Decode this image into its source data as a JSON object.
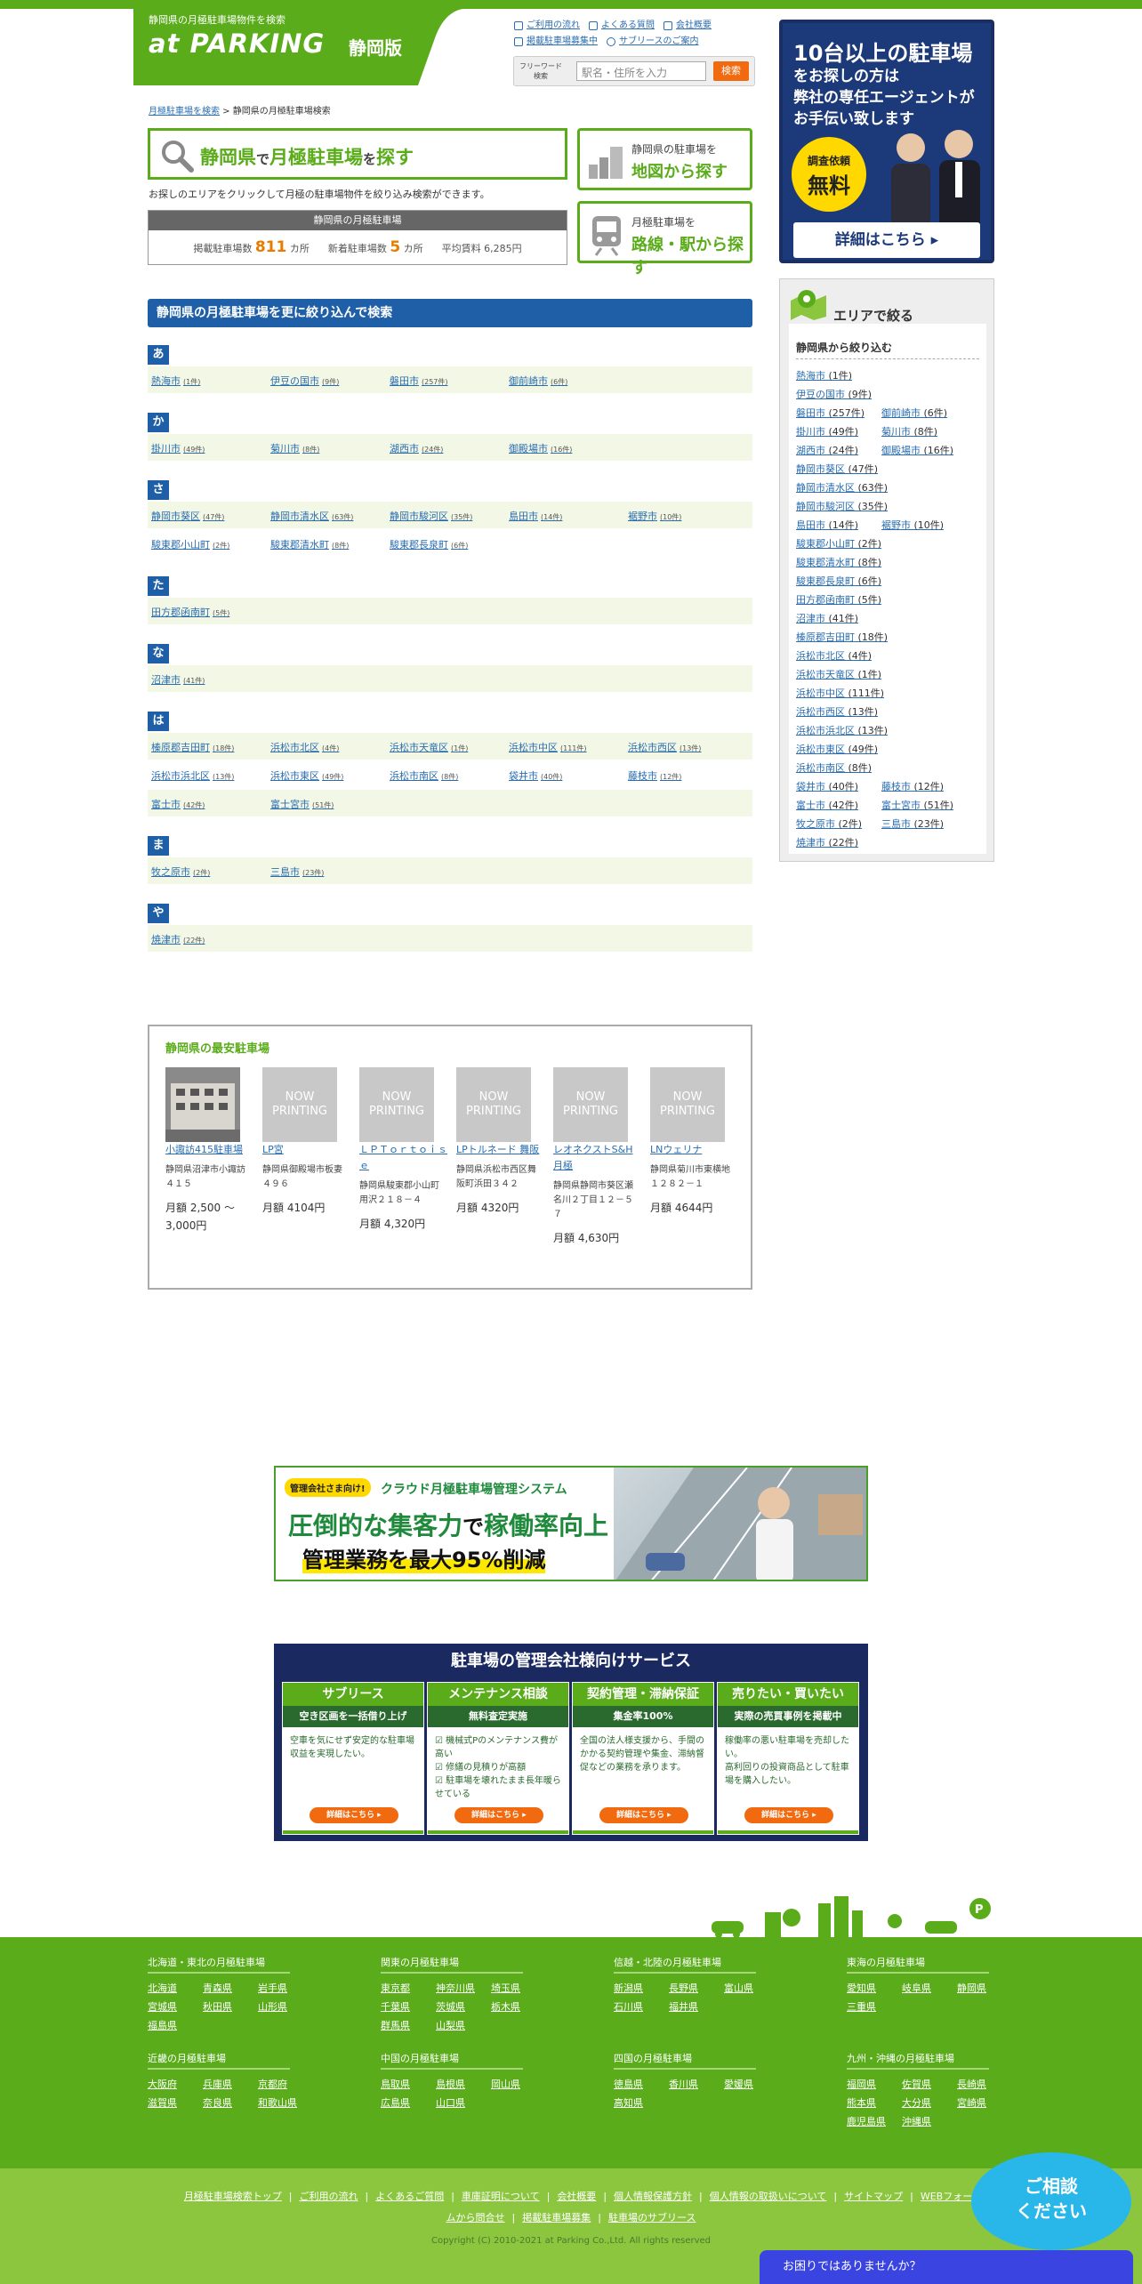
{
  "header": {
    "tagline": "静岡県の月極駐車場物件を検索",
    "logo": "at PARKING",
    "edition": "静岡版",
    "links": [
      "ご利用の流れ",
      "よくある質問",
      "会社概要",
      "掲載駐車場募集中",
      "サブリースのご案内"
    ],
    "search_label": "フリーワード検索",
    "search_placeholder": "駅名・住所を入力",
    "search_button": "検索"
  },
  "ad_top": {
    "line1": "10台以上の駐車場",
    "line2": "をお探しの方は",
    "line3": "弊社の専任エージェントが",
    "line4": "お手伝い致します",
    "badge1": "調査依頼",
    "badge2": "無料",
    "detail": "詳細はこちら ▸"
  },
  "breadcrumb": {
    "home": "月極駐車場を検索",
    "sep": " > ",
    "current": "静岡県の月極駐車場検索"
  },
  "title": {
    "pref": "静岡県",
    "de": "で",
    "mid": "月極駐車場",
    "wo": "を",
    "end": "探す"
  },
  "intro": "お探しのエリアをクリックして月極の駐車場物件を絞り込み検索ができます。",
  "stats": {
    "header": "静岡県の月極駐車場",
    "label1": "掲載駐車場数",
    "value1": "811",
    "unit1": "カ所",
    "label2": "新着駐車場数",
    "value2": "5",
    "unit2": "カ所",
    "label3": "平均賃料",
    "value3": "6,285円"
  },
  "side_buttons": [
    {
      "l1": "静岡県の駐車場を",
      "l2": "地図から探す"
    },
    {
      "l1": "月極駐車場を",
      "l2": "路線・駅から探す"
    }
  ],
  "section_title": "静岡県の月極駐車場を更に絞り込んで検索",
  "kana_groups": [
    {
      "kana": "あ",
      "rows": [
        [
          [
            "熱海市",
            "(1件)"
          ],
          [
            "伊豆の国市",
            "(9件)"
          ],
          [
            "磐田市",
            "(257件)"
          ],
          [
            "御前崎市",
            "(6件)"
          ]
        ]
      ]
    },
    {
      "kana": "か",
      "rows": [
        [
          [
            "掛川市",
            "(49件)"
          ],
          [
            "菊川市",
            "(8件)"
          ],
          [
            "湖西市",
            "(24件)"
          ],
          [
            "御殿場市",
            "(16件)"
          ]
        ]
      ]
    },
    {
      "kana": "さ",
      "rows": [
        [
          [
            "静岡市葵区",
            "(47件)"
          ],
          [
            "静岡市清水区",
            "(63件)"
          ],
          [
            "静岡市駿河区",
            "(35件)"
          ],
          [
            "島田市",
            "(14件)"
          ],
          [
            "裾野市",
            "(10件)"
          ]
        ],
        [
          [
            "駿東郡小山町",
            "(2件)"
          ],
          [
            "駿東郡清水町",
            "(8件)"
          ],
          [
            "駿東郡長泉町",
            "(6件)"
          ]
        ]
      ]
    },
    {
      "kana": "た",
      "rows": [
        [
          [
            "田方郡函南町",
            "(5件)"
          ]
        ]
      ]
    },
    {
      "kana": "な",
      "rows": [
        [
          [
            "沼津市",
            "(41件)"
          ]
        ]
      ]
    },
    {
      "kana": "は",
      "rows": [
        [
          [
            "榛原郡吉田町",
            "(18件)"
          ],
          [
            "浜松市北区",
            "(4件)"
          ],
          [
            "浜松市天竜区",
            "(1件)"
          ],
          [
            "浜松市中区",
            "(111件)"
          ],
          [
            "浜松市西区",
            "(13件)"
          ]
        ],
        [
          [
            "浜松市浜北区",
            "(13件)"
          ],
          [
            "浜松市東区",
            "(49件)"
          ],
          [
            "浜松市南区",
            "(8件)"
          ],
          [
            "袋井市",
            "(40件)"
          ],
          [
            "藤枝市",
            "(12件)"
          ]
        ],
        [
          [
            "富士市",
            "(42件)"
          ],
          [
            "富士宮市",
            "(51件)"
          ]
        ]
      ]
    },
    {
      "kana": "ま",
      "rows": [
        [
          [
            "牧之原市",
            "(2件)"
          ],
          [
            "三島市",
            "(23件)"
          ]
        ]
      ]
    },
    {
      "kana": "や",
      "rows": [
        [
          [
            "焼津市",
            "(22件)"
          ]
        ]
      ]
    }
  ],
  "cheapest": {
    "title": "静岡県の最安駐車場",
    "items": [
      {
        "img": "",
        "name": "小諏訪415駐車場",
        "addr": "静岡県沼津市小諏訪４１５",
        "price": "月額 2,500 ～ 3,000円"
      },
      {
        "img": "NOW PRINTING",
        "name": "LP宮",
        "addr": "静岡県御殿場市板妻４９６",
        "price": "月額 4104円"
      },
      {
        "img": "NOW PRINTING",
        "name": "ＬＰＴｏｒｔｏｉｓｅ",
        "addr": "静岡県駿東郡小山町用沢２１８－４",
        "price": "月額 4,320円"
      },
      {
        "img": "NOW PRINTING",
        "name": "LPトルネード 舞阪",
        "addr": "静岡県浜松市西区舞阪町浜田３４２",
        "price": "月額 4320円"
      },
      {
        "img": "NOW PRINTING",
        "name": "レオネクストS&H月極",
        "addr": "静岡県静岡市葵区瀬名川２丁目１２－５７",
        "price": "月額 4,630円"
      },
      {
        "img": "NOW PRINTING",
        "name": "LNウェリナ",
        "addr": "静岡県菊川市東横地１２８２－１",
        "price": "月額 4644円"
      }
    ]
  },
  "banner1": {
    "tag": "管理会社さま向け!",
    "title": "クラウド月極駐車場管理システム",
    "l1a": "圧倒的な集客力",
    "l1b": "で",
    "l1c": "稼働率向上",
    "l2": "管理業務を最大95%削減"
  },
  "banner2": {
    "title": "駐車場の管理会社様向けサービス",
    "cols": [
      {
        "h": "サブリース",
        "s": "空き区画を一括借り上げ",
        "t": "空車を気にせず安定的な駐車場収益を実現したい。",
        "b": "詳細はこちら ▸"
      },
      {
        "h": "メンテナンス相談",
        "s": "無料査定実施",
        "t": "☑ 機械式Pのメンテナンス費が高い\n☑ 修繕の見積りが高額\n☑ 駐車場を壊れたまま長年暖らせている",
        "b": "詳細はこちら ▸"
      },
      {
        "h": "契約管理・滞納保証",
        "s": "集金率100%",
        "t": "全国の法人様支援から、手間のかかる契約管理や集金、滞納督促などの業務を承ります。",
        "b": "詳細はこちら ▸"
      },
      {
        "h": "売りたい・買いたい",
        "s": "実際の売買事例を掲載中",
        "t": "稼働率の悪い駐車場を売却したい。\n高利回りの投資商品として駐車場を購入したい。",
        "b": "詳細はこちら ▸"
      }
    ]
  },
  "sidebar": {
    "title": "エリアで絞る",
    "subtitle": "静岡県から絞り込む",
    "rows": [
      [
        [
          "熱海市",
          "(1件)"
        ]
      ],
      [
        [
          "伊豆の国市",
          "(9件)"
        ]
      ],
      [
        [
          "磐田市",
          "(257件)"
        ],
        [
          "御前崎市",
          "(6件)"
        ]
      ],
      [
        [
          "掛川市",
          "(49件)"
        ],
        [
          "菊川市",
          "(8件)"
        ]
      ],
      [
        [
          "湖西市",
          "(24件)"
        ],
        [
          "御殿場市",
          "(16件)"
        ]
      ],
      [
        [
          "静岡市葵区",
          "(47件)"
        ]
      ],
      [
        [
          "静岡市清水区",
          "(63件)"
        ]
      ],
      [
        [
          "静岡市駿河区",
          "(35件)"
        ]
      ],
      [
        [
          "島田市",
          "(14件)"
        ],
        [
          "裾野市",
          "(10件)"
        ]
      ],
      [
        [
          "駿東郡小山町",
          "(2件)"
        ]
      ],
      [
        [
          "駿東郡清水町",
          "(8件)"
        ]
      ],
      [
        [
          "駿東郡長泉町",
          "(6件)"
        ]
      ],
      [
        [
          "田方郡函南町",
          "(5件)"
        ]
      ],
      [
        [
          "沼津市",
          "(41件)"
        ]
      ],
      [
        [
          "榛原郡吉田町",
          "(18件)"
        ]
      ],
      [
        [
          "浜松市北区",
          "(4件)"
        ]
      ],
      [
        [
          "浜松市天竜区",
          "(1件)"
        ]
      ],
      [
        [
          "浜松市中区",
          "(111件)"
        ]
      ],
      [
        [
          "浜松市西区",
          "(13件)"
        ]
      ],
      [
        [
          "浜松市浜北区",
          "(13件)"
        ]
      ],
      [
        [
          "浜松市東区",
          "(49件)"
        ]
      ],
      [
        [
          "浜松市南区",
          "(8件)"
        ]
      ],
      [
        [
          "袋井市",
          "(40件)"
        ],
        [
          "藤枝市",
          "(12件)"
        ]
      ],
      [
        [
          "富士市",
          "(42件)"
        ],
        [
          "富士宮市",
          "(51件)"
        ]
      ],
      [
        [
          "牧之原市",
          "(2件)"
        ],
        [
          "三島市",
          "(23件)"
        ]
      ],
      [
        [
          "焼津市",
          "(22件)"
        ]
      ]
    ]
  },
  "footer_regions": [
    {
      "h": "北海道・東北の月極駐車場",
      "items": [
        "北海道",
        "青森県",
        "岩手県",
        "宮城県",
        "秋田県",
        "山形県",
        "福島県"
      ]
    },
    {
      "h": "関東の月極駐車場",
      "items": [
        "東京都",
        "神奈川県",
        "埼玉県",
        "千葉県",
        "茨城県",
        "栃木県",
        "群馬県",
        "山梨県"
      ]
    },
    {
      "h": "信越・北陸の月極駐車場",
      "items": [
        "新潟県",
        "長野県",
        "富山県",
        "石川県",
        "福井県"
      ]
    },
    {
      "h": "東海の月極駐車場",
      "items": [
        "愛知県",
        "岐阜県",
        "静岡県",
        "三重県"
      ]
    },
    {
      "h": "近畿の月極駐車場",
      "items": [
        "大阪府",
        "兵庫県",
        "京都府",
        "滋賀県",
        "奈良県",
        "和歌山県"
      ]
    },
    {
      "h": "中国の月極駐車場",
      "items": [
        "鳥取県",
        "島根県",
        "岡山県",
        "広島県",
        "山口県"
      ]
    },
    {
      "h": "四国の月極駐車場",
      "items": [
        "徳島県",
        "香川県",
        "愛媛県",
        "高知県"
      ]
    },
    {
      "h": "九州・沖縄の月極駐車場",
      "items": [
        "福岡県",
        "佐賀県",
        "長崎県",
        "熊本県",
        "大分県",
        "宮崎県",
        "鹿児島県",
        "沖縄県"
      ]
    }
  ],
  "footer_links": [
    "月極駐車場検索トップ",
    "ご利用の流れ",
    "よくあるご質問",
    "車庫証明について",
    "会社概要",
    "個人情報保護方針",
    "個人情報の取扱いについて",
    "サイトマップ",
    "WEBフォームから問合せ",
    "掲載駐車場募集",
    "駐車場のサブリース"
  ],
  "copyright": "Copyright (C) 2010-2021 at Parking Co.,Ltd. All rights reserved",
  "chat": {
    "bubble1": "ご相談",
    "bubble2": "ください",
    "bar": "お困りではありませんか？"
  },
  "colors": {
    "green": "#5aac1b",
    "blue": "#1f5fa8",
    "orange": "#f26a10"
  }
}
